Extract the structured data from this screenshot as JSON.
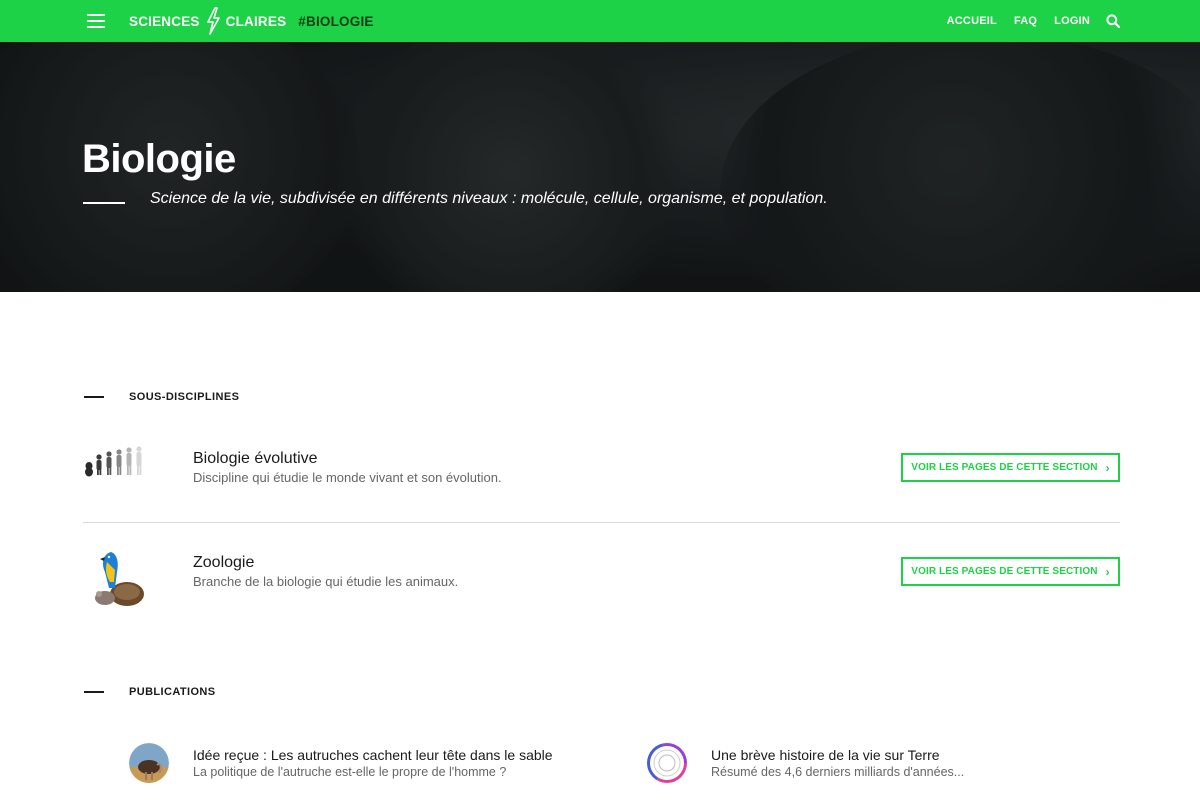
{
  "navbar": {
    "brand_left": "SCIENCES",
    "brand_right": "CLAIRES",
    "hashtag": "#BIOLOGIE",
    "links": [
      "ACCUEIL",
      "FAQ",
      "LOGIN"
    ],
    "accent_color": "#1ed247"
  },
  "hero": {
    "title": "Biologie",
    "subtitle": "Science de la vie, subdivisée en différents niveaux : molécule, cellule, organisme, et population."
  },
  "subdisciplines": {
    "heading": "SOUS-DISCIPLINES",
    "items": [
      {
        "title": "Biologie évolutive",
        "description": "Discipline qui étudie le monde vivant et son évolution.",
        "button": "VOIR LES PAGES DE CETTE SECTION"
      },
      {
        "title": "Zoologie",
        "description": "Branche de la biologie qui étudie les animaux.",
        "button": "VOIR LES PAGES DE CETTE SECTION"
      }
    ]
  },
  "publications": {
    "heading": "PUBLICATIONS",
    "items": [
      {
        "title": "Idée reçue : Les autruches cachent leur tête dans le sable",
        "description": "La politique de l'autruche est-elle le propre de l'homme ?"
      },
      {
        "title": "Une brève histoire de la vie sur Terre",
        "description": "Résumé des 4,6 derniers milliards d'années..."
      }
    ]
  }
}
